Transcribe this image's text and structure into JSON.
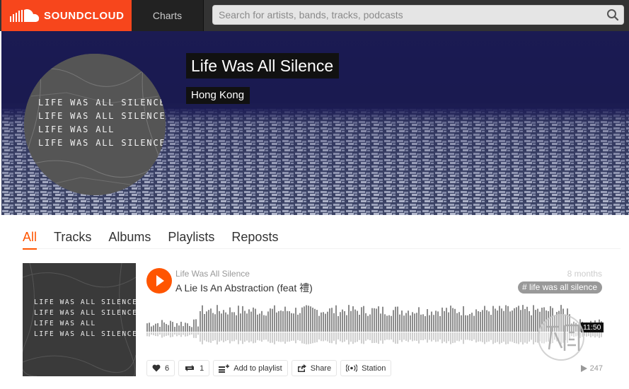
{
  "header": {
    "brand": "SOUNDCLOUD",
    "nav_charts": "Charts",
    "search_placeholder": "Search for artists, bands, tracks, podcasts"
  },
  "artist": {
    "name": "Life Was All Silence",
    "location": "Hong Kong",
    "avatar_lines": [
      "LIFE WAS ALL SILENCE",
      "LIFE WAS ALL SILENCE",
      "LIFE WAS ALL",
      "LIFE WAS ALL SILENCE"
    ]
  },
  "tabs": [
    {
      "label": "All",
      "active": true
    },
    {
      "label": "Tracks",
      "active": false
    },
    {
      "label": "Albums",
      "active": false
    },
    {
      "label": "Playlists",
      "active": false
    },
    {
      "label": "Reposts",
      "active": false
    }
  ],
  "track": {
    "user": "Life Was All Silence",
    "title": "A Lie Is An Abstraction (feat 禮)",
    "posted": "8 months",
    "tag": "# life was all silence",
    "duration": "11:50",
    "likes": "6",
    "reposts": "1",
    "add_to_playlist": "Add to playlist",
    "share": "Share",
    "station": "Station",
    "plays": "247",
    "cover_lines": [
      "LIFE WAS ALL SILENCE",
      "LIFE WAS ALL SILENCE",
      "LIFE WAS ALL",
      "LIFE WAS ALL SILENCE"
    ]
  },
  "colors": {
    "brand": "#f7461c",
    "accent": "#f50",
    "header_bg": "#333333",
    "tag_bg": "#999999"
  },
  "icons": {
    "search": "search-icon",
    "play": "play-icon",
    "like": "heart-icon",
    "repost": "repost-icon",
    "playlist": "add-to-playlist-icon",
    "share": "share-icon",
    "station": "station-icon",
    "plays": "play-count-icon"
  }
}
